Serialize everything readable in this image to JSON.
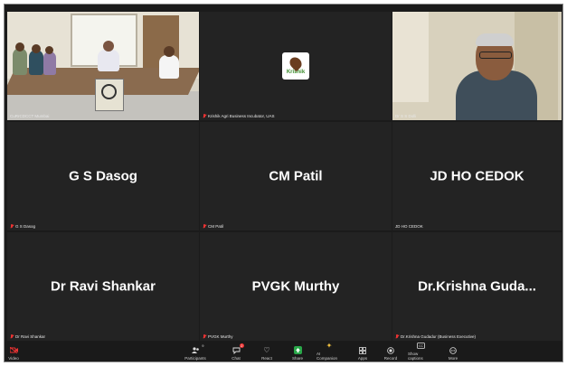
{
  "tiles": [
    {
      "kind": "video-room",
      "label": "CuRrCDCCT Mumbai",
      "muted": false,
      "active": true
    },
    {
      "kind": "logo",
      "logo_text": "Krishik",
      "label": "Krishik Agri Business Incubator, UAS",
      "muted": true
    },
    {
      "kind": "video-man",
      "label": "Dr S S Dolli",
      "muted": false
    },
    {
      "kind": "name",
      "display_name": "G S Dasog",
      "label": "G S Dasog",
      "muted": true
    },
    {
      "kind": "name",
      "display_name": "CM Patil",
      "label": "CM Patil",
      "muted": true
    },
    {
      "kind": "name",
      "display_name": "JD HO CEDOK",
      "label": "JD HO CEDOK",
      "muted": false
    },
    {
      "kind": "name",
      "display_name": "Dr Ravi Shankar",
      "label": "Dr Ravi Shankar",
      "muted": true
    },
    {
      "kind": "name",
      "display_name": "PVGK Murthy",
      "label": "PVGK Murthy",
      "muted": true
    },
    {
      "kind": "name",
      "display_name": "Dr.Krishna  Guda...",
      "label": "Dr.Krishna Gudadur (Business Executive)",
      "muted": true
    }
  ],
  "toolbar": {
    "video": {
      "label": "Video",
      "icon": "video-off-icon"
    },
    "participants": {
      "label": "Participants",
      "count": "9",
      "icon": "participants-icon"
    },
    "chat": {
      "label": "Chat",
      "badge": "2",
      "icon": "chat-icon"
    },
    "react": {
      "label": "React",
      "icon": "heart-icon"
    },
    "share": {
      "label": "Share",
      "icon": "share-icon"
    },
    "ai": {
      "label": "AI Companion",
      "icon": "sparkle-icon"
    },
    "apps": {
      "label": "Apps",
      "icon": "apps-icon"
    },
    "record": {
      "label": "Record",
      "icon": "record-icon"
    },
    "captions": {
      "label": "Show captions",
      "icon": "captions-icon"
    },
    "more": {
      "label": "More",
      "icon": "more-icon"
    }
  },
  "colors": {
    "active_speaker": "#2ed36b",
    "muted": "#e33333",
    "tile_bg": "#232323",
    "app_bg": "#1b1b1b"
  }
}
